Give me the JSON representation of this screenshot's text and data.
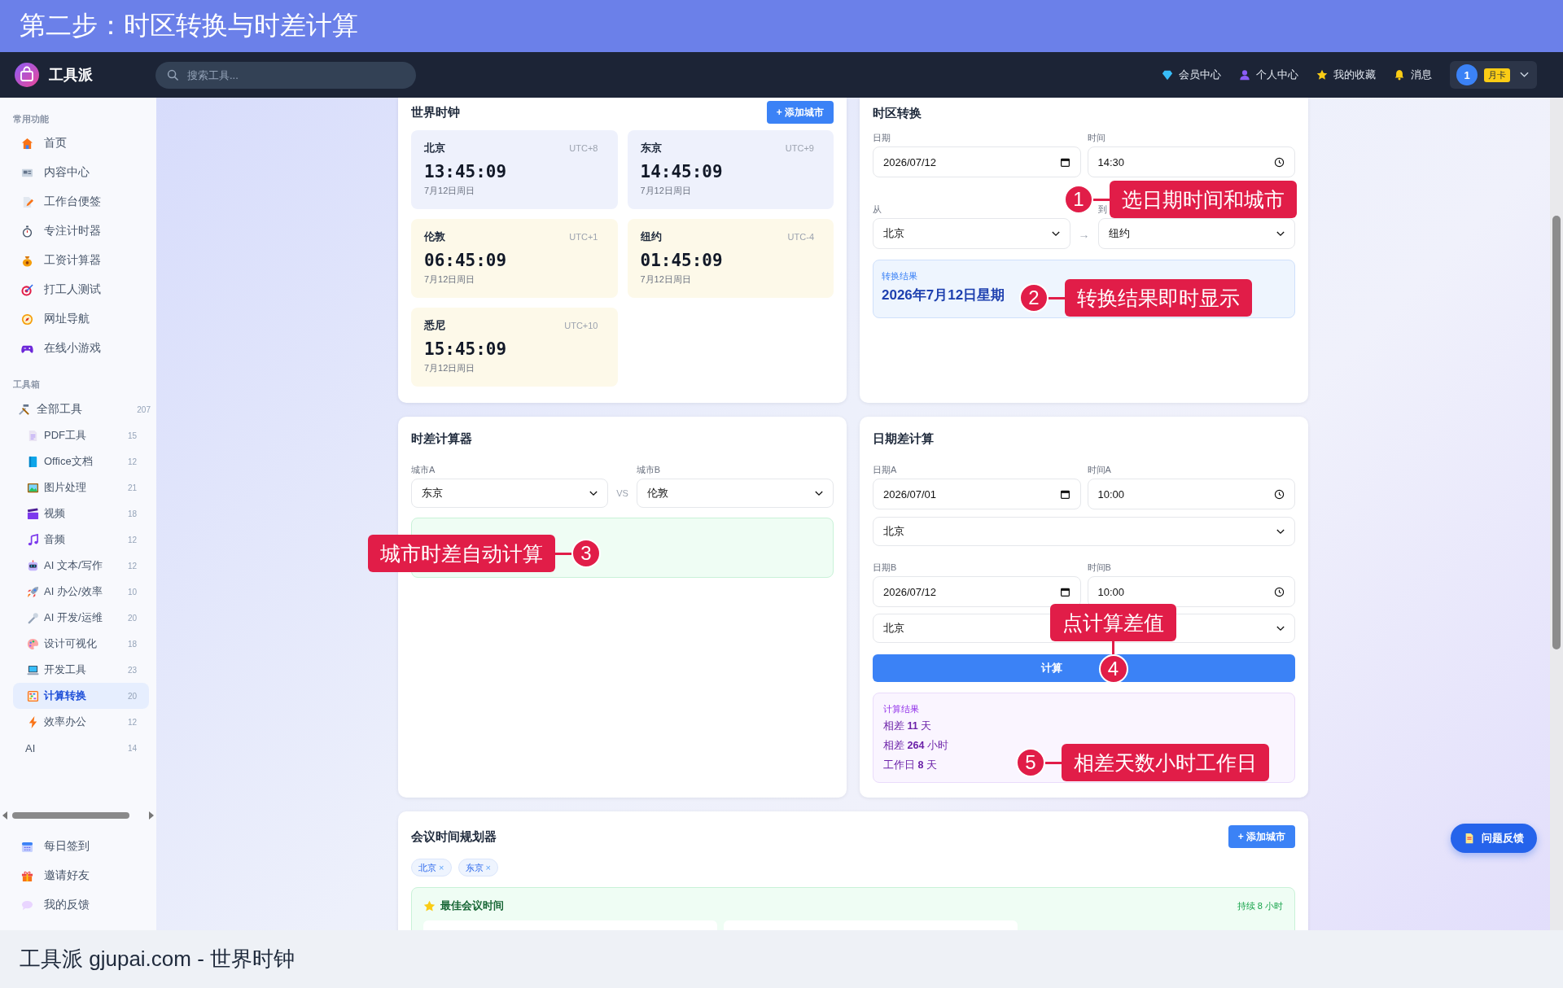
{
  "banner": {
    "title": "第二步：时区转换与时差计算"
  },
  "navbar": {
    "logo_text": "工具派",
    "search": {
      "placeholder": "搜索工具..."
    },
    "links": [
      "会员中心",
      "个人中心",
      "我的收藏",
      "消息"
    ],
    "user": {
      "avatar": "1",
      "badge": "月卡"
    }
  },
  "sidebar": {
    "sections": [
      {
        "title": "常用功能",
        "items": [
          {
            "label": "首页",
            "selected": false
          },
          {
            "label": "内容中心",
            "selected": false
          },
          {
            "label": "工作台便签",
            "selected": false
          },
          {
            "label": "专注计时器",
            "selected": false
          },
          {
            "label": "工资计算器",
            "selected": false
          },
          {
            "label": "打工人测试",
            "selected": false
          },
          {
            "label": "网址导航",
            "selected": false
          },
          {
            "label": "在线小游戏",
            "selected": false
          }
        ]
      },
      {
        "title": "工具箱",
        "items": [
          {
            "label": "全部工具",
            "count": "207",
            "selected": false,
            "children": [
              {
                "label": "PDF工具",
                "count": "15",
                "selected": false,
                "has_icon": true
              },
              {
                "label": "Office文档",
                "count": "12",
                "selected": false,
                "has_icon": true
              },
              {
                "label": "图片处理",
                "count": "21",
                "selected": false,
                "has_icon": true
              },
              {
                "label": "视频",
                "count": "18",
                "selected": false,
                "has_icon": true
              },
              {
                "label": "音频",
                "count": "12",
                "selected": false,
                "has_icon": true
              },
              {
                "label": "AI 文本/写作",
                "count": "12",
                "selected": false,
                "has_icon": true
              },
              {
                "label": "AI 办公/效率",
                "count": "10",
                "selected": false,
                "has_icon": true
              },
              {
                "label": "AI 开发/运维",
                "count": "20",
                "selected": false,
                "has_icon": true
              },
              {
                "label": "设计可视化",
                "count": "18",
                "selected": false,
                "has_icon": true
              },
              {
                "label": "开发工具",
                "count": "23",
                "selected": false,
                "has_icon": true
              },
              {
                "label": "计算转换",
                "count": "20",
                "selected": true,
                "has_icon": true
              },
              {
                "label": "效率办公",
                "count": "12",
                "selected": false,
                "has_icon": true
              },
              {
                "label": "AI",
                "count": "14",
                "selected": false,
                "has_icon": false
              }
            ]
          }
        ]
      }
    ],
    "footer_items": [
      "每日签到",
      "邀请好友",
      "我的反馈"
    ]
  },
  "world_clock": {
    "title": "世界时钟",
    "add_button": "+ 添加城市",
    "clocks": [
      {
        "city": "北京",
        "utc": "UTC+8",
        "time": "13:45:09",
        "date": "7月12日周日",
        "color": "#eef1fc"
      },
      {
        "city": "东京",
        "utc": "UTC+9",
        "time": "14:45:09",
        "date": "7月12日周日",
        "color": "#eef1fc"
      },
      {
        "city": "伦敦",
        "utc": "UTC+1",
        "time": "06:45:09",
        "date": "7月12日周日",
        "color": "#fdf9e9"
      },
      {
        "city": "纽约",
        "utc": "UTC-4",
        "time": "01:45:09",
        "date": "7月12日周日",
        "color": "#fdf9e9"
      },
      {
        "city": "悉尼",
        "utc": "UTC+10",
        "time": "15:45:09",
        "date": "7月12日周日",
        "color": "#fdf9e9"
      }
    ]
  },
  "tz_converter": {
    "title": "时区转换",
    "date": {
      "label": "日期",
      "value": "2026/07/12"
    },
    "time": {
      "label": "时间",
      "value": "14:30"
    },
    "from": {
      "label": "从",
      "value": "北京"
    },
    "arrow": "→",
    "to": {
      "label": "到",
      "value": "纽约"
    },
    "result": {
      "label": "转换结果",
      "value": "2026年7月12日星期"
    }
  },
  "time_diff": {
    "title": "时差计算器",
    "city_a": {
      "label": "城市A",
      "value": "东京"
    },
    "vs": "VS",
    "city_b": {
      "label": "城市B",
      "value": "伦敦"
    }
  },
  "date_diff": {
    "title": "日期差计算",
    "date_a": {
      "label": "日期A",
      "value": "2026/07/01"
    },
    "time_a": {
      "label": "时间A",
      "value": "10:00"
    },
    "city_a": "北京",
    "date_b": {
      "label": "日期B",
      "value": "2026/07/12"
    },
    "time_b": {
      "label": "时间B",
      "value": "10:00"
    },
    "city_b": "北京",
    "button": "计算",
    "result": {
      "label": "计算结果",
      "lines": [
        "相差 **11** 天",
        "相差 **264** 小时",
        "工作日 **8** 天"
      ]
    }
  },
  "meeting": {
    "title": "会议时间规划器",
    "add_button": "+ 添加城市",
    "chips": [
      {
        "label": "北京",
        "remove": "×"
      },
      {
        "label": "东京",
        "remove": "×"
      }
    ],
    "best": {
      "title": "最佳会议时间",
      "duration": "持续 8 小时"
    }
  },
  "feedback_button": "问题反馈",
  "annotations": [
    {
      "number": "1",
      "text": "选日期时间和城市"
    },
    {
      "number": "2",
      "text": "转换结果即时显示"
    },
    {
      "number": "3",
      "text": "城市时差自动计算"
    },
    {
      "number": "4",
      "text": "点计算差值"
    },
    {
      "number": "5",
      "text": "相差天数小时工作日"
    }
  ],
  "caption": "工具派 gjupai.com - 世界时钟"
}
